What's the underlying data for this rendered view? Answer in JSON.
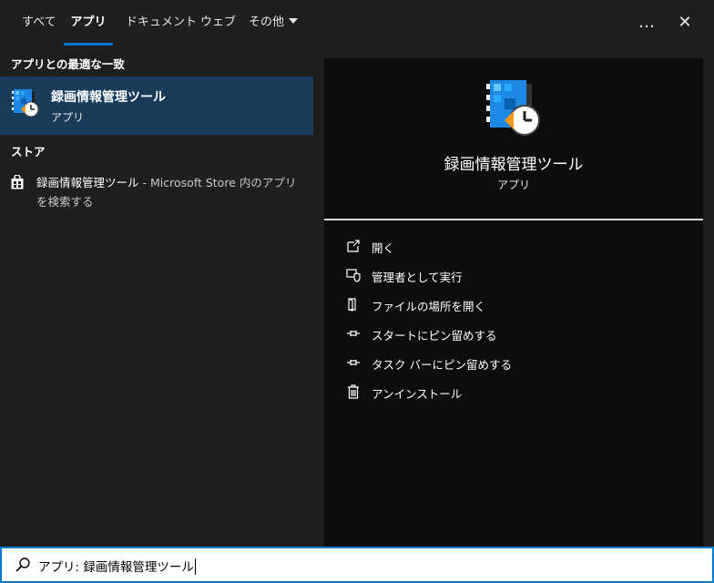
{
  "tabs": [
    {
      "label": "すべて"
    },
    {
      "label": "アプリ",
      "active": true
    },
    {
      "label": "ドキュメント"
    },
    {
      "label": "ウェブ"
    },
    {
      "label": "その他"
    }
  ],
  "top_icons": {
    "more": "…",
    "more_icon": "ellipsis-icon",
    "close": "✕",
    "close_icon": "close-icon"
  },
  "best_match": {
    "header": "アプリとの最適な一致",
    "title": "録画情報管理ツール",
    "subtitle": "アプリ",
    "icon": "recorder-app-icon"
  },
  "store": {
    "header": "ストア",
    "item_title": "録画情報管理ツール",
    "item_separator": " - ",
    "item_desc": "Microsoft Store 内のアプリを検索する",
    "icon": "store-bag-icon"
  },
  "detail": {
    "title": "録画情報管理ツール",
    "subtitle": "アプリ",
    "icon": "recorder-app-icon",
    "actions": [
      {
        "label": "開く",
        "icon": "open-icon"
      },
      {
        "label": "管理者として実行",
        "icon": "shield-icon"
      },
      {
        "label": "ファイルの場所を開く",
        "icon": "file-location-icon"
      },
      {
        "label": "スタートにピン留めする",
        "icon": "pin-icon"
      },
      {
        "label": "タスク バーにピン留めする",
        "icon": "pin-icon"
      },
      {
        "label": "アンインストール",
        "icon": "trash-icon"
      }
    ]
  },
  "search": {
    "value": "アプリ: 録画情報管理ツール",
    "icon": "search-icon"
  },
  "colors": {
    "accent": "#0078d4",
    "selected_bg": "#183c59",
    "panel_bg": "#0d0d0d",
    "bg": "#1f1f1f"
  }
}
